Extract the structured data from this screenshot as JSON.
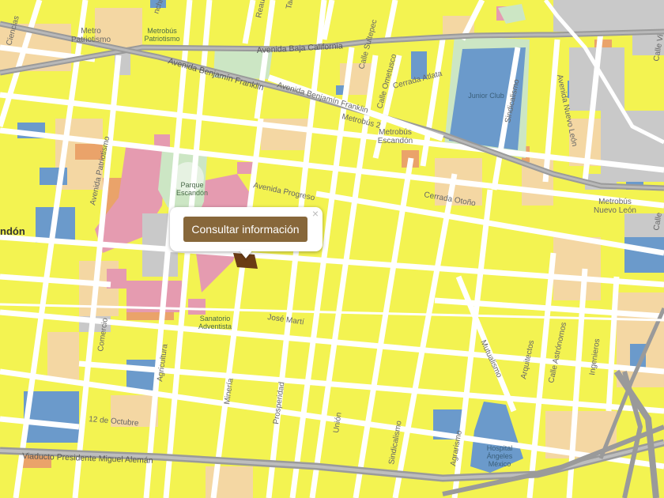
{
  "popup": {
    "button_label": "Consultar información",
    "close_symbol": "×"
  },
  "labels": {
    "avenida_baja_california": "Avenida Baja California",
    "avenida_benjamin_franklin_1": "Avenida Benjamín Franklin",
    "avenida_benjamin_franklin_2": "Avenida Benjamín Franklin",
    "avenida_progreso": "Avenida Progreso",
    "avenida_patriotismo": "Avenida Patriotismo",
    "avenida_nuevo_leon": "Avenida Nuevo León",
    "jose_marti": "José Martí",
    "cerrada_otono": "Cerrada Otoño",
    "cerrada_atlata": "Cerrada Atlata",
    "calle_sultepec": "Calle Sultepec",
    "calle_ometusco": "Calle Ometusco",
    "sindicalismo_1": "Sindicalismo",
    "sindicalismo_2": "Sindicalismo",
    "mutualismo": "Mutualismo",
    "arquitectos": "Arquitectos",
    "calle_astronomos": "Calle Astrónomos",
    "ingenieros": "Ingenieros",
    "agrarismo": "Agrarismo",
    "union": "Unión",
    "prosperidad": "Prosperidad",
    "mineria": "Minería",
    "agricultura": "Agricultura",
    "comercio": "Comercio",
    "doce_de_octubre": "12 de Octubre",
    "viaducto": "Viaducto Presidente Miguel Alemán",
    "ciencias": "Ciencias",
    "calle_vi": "Calle Vi",
    "calle_a": "Calle",
    "reaul": "Reaul",
    "tacubaya": "Tacubaya",
    "nchi": "nchi",
    "metro_patriotismo": "Metro\nPatriotismo",
    "metrobus_patriotismo": "Metrobús\nPatriotismo",
    "metrobus_2": "Metrobús 2",
    "metrobus_escandon": "Metrobús\nEscandón",
    "metrobus_nuevo_leon": "Metrobús\nNuevo León",
    "parque_escandon": "Parque\nEscandón",
    "sanatorio_adventista": "Sanatorio\nAdventista",
    "junior_club": "Junior Club",
    "hospital_angeles": "Hospital\nÁngeles\nMéxico",
    "escandon": "ndón"
  },
  "colors": {
    "residential": "#f3f351",
    "commercial": "#f4d7a3",
    "mixed": "#eaa36a",
    "services": "#e59bb0",
    "equipment": "#6b9acb",
    "industrial": "#c9c9c9",
    "park": "#cce6c4",
    "road": "#ffffff",
    "highway": "#9a9a9a",
    "selected": "#6b3c14",
    "button": "#87673a"
  }
}
